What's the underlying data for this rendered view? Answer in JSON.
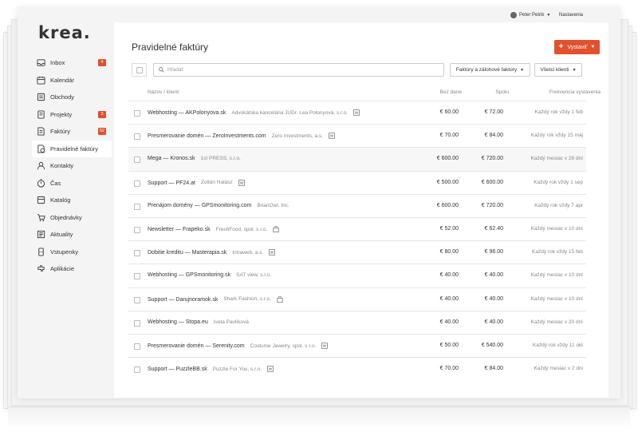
{
  "app": {
    "logo": "krea."
  },
  "topbar": {
    "user_name": "Peter Petrik",
    "settings_label": "Nastavenia"
  },
  "sidebar": {
    "items": [
      {
        "label": "Inbox",
        "icon": "inbox-icon",
        "badge": "4"
      },
      {
        "label": "Kalendár",
        "icon": "calendar-icon",
        "badge": ""
      },
      {
        "label": "Obchody",
        "icon": "deals-icon",
        "badge": ""
      },
      {
        "label": "Projekty",
        "icon": "projects-icon",
        "badge": "3"
      },
      {
        "label": "Faktúry",
        "icon": "invoices-icon",
        "badge": "52"
      },
      {
        "label": "Pravidelné faktúry",
        "icon": "recurring-invoices-icon",
        "badge": "",
        "active": true
      },
      {
        "label": "Kontakty",
        "icon": "contacts-icon",
        "badge": ""
      },
      {
        "label": "Čas",
        "icon": "time-icon",
        "badge": ""
      },
      {
        "label": "Katalóg",
        "icon": "catalog-icon",
        "badge": ""
      },
      {
        "label": "Objednávky",
        "icon": "orders-icon",
        "badge": ""
      },
      {
        "label": "Aktuality",
        "icon": "news-icon",
        "badge": ""
      },
      {
        "label": "Vstupenky",
        "icon": "tickets-icon",
        "badge": ""
      },
      {
        "label": "Aplikácie",
        "icon": "apps-icon",
        "badge": ""
      }
    ]
  },
  "page": {
    "title": "Pravidelné faktúry",
    "create_button": "Vystaviť",
    "search_placeholder": "Hľadať",
    "filter_type": "Faktúry a zálohové faktúry",
    "filter_client": "Všetci klienti"
  },
  "table": {
    "headers": {
      "name": "Názov / klient",
      "bez_dane": "Bez dane",
      "spolu": "Spolu",
      "freq": "Frekvencia vystavenia"
    },
    "rows": [
      {
        "name": "Webhosting — AKPolonyova.sk",
        "client": "Advokátska kancelária JUDr. Lea Polonyová, s.r.o.",
        "icon": "document-icon",
        "bez": "€ 60.00",
        "spolu": "€ 72.00",
        "freq": "Každý rok vždy 1 feb"
      },
      {
        "name": "Presmerovanie domén — ZeroInvestments.com",
        "client": "Zero Investments, a.s.",
        "icon": "document-icon",
        "bez": "€ 70.00",
        "spolu": "€ 84.00",
        "freq": "Každý rok vždy 15 máj"
      },
      {
        "name": "Mega — Kronos.sk",
        "client": "1st PRESS, s.r.o.",
        "icon": "",
        "bez": "€ 600.00",
        "spolu": "€ 720.00",
        "freq": "Každý mesiac v 28 dní",
        "highlight": true
      },
      {
        "name": "Support — PF24.at",
        "client": "Zoltán Halász",
        "icon": "document-icon",
        "bez": "€ 500.00",
        "spolu": "€ 600.00",
        "freq": "Každý rok vždy 1 sep"
      },
      {
        "name": "Prenájom domény — GPSmonitoring.com",
        "client": "BrianOwl, Inc.",
        "icon": "",
        "bez": "€ 600.00",
        "spolu": "€ 720.00",
        "freq": "Každý rok vždy 7 apr"
      },
      {
        "name": "Newsletter — Frapeko.sk",
        "client": "FreshFood, spol. s r.o.",
        "icon": "bag-icon",
        "bez": "€ 52.00",
        "spolu": "€ 62.40",
        "freq": "Každý mesiac v 10 dní"
      },
      {
        "name": "Dobitie kreditu — Masterapia.sk",
        "client": "Intraweb, a.s.",
        "icon": "document-icon",
        "bez": "€ 80.00",
        "spolu": "€ 96.00",
        "freq": "Každý rok vždy 15 feb"
      },
      {
        "name": "Webhosting — GPSmonitoring.sk",
        "client": "SAT view, s.r.o.",
        "icon": "",
        "bez": "€ 40.00",
        "spolu": "€ 40.00",
        "freq": "Každý mesiac v 10 dní"
      },
      {
        "name": "Support — Darujnoramok.sk",
        "client": "Shark Fashion, s.r.o.",
        "icon": "bag-icon",
        "bez": "€ 40.00",
        "spolu": "€ 40.00",
        "freq": "Každý mesiac v 10 dní"
      },
      {
        "name": "Webhosting — Stopa.eu",
        "client": "Iveta Pavlíková",
        "icon": "",
        "bez": "€ 40.00",
        "spolu": "€ 40.00",
        "freq": "Každý mesiac v 20 dní"
      },
      {
        "name": "Presmerovanie domén — Serenity.com",
        "client": "Costume Jewelry, spol. s r.o.",
        "icon": "document-icon",
        "bez": "€ 50.00",
        "spolu": "€ 540.00",
        "freq": "Každý rok vždy 11 okt"
      },
      {
        "name": "Support — PuzzleBB.sk",
        "client": "Puzzle For You, s.r.o.",
        "icon": "document-icon",
        "bez": "€ 70.00",
        "spolu": "€ 84.00",
        "freq": "Každý mesiac v 2 dni"
      }
    ]
  }
}
